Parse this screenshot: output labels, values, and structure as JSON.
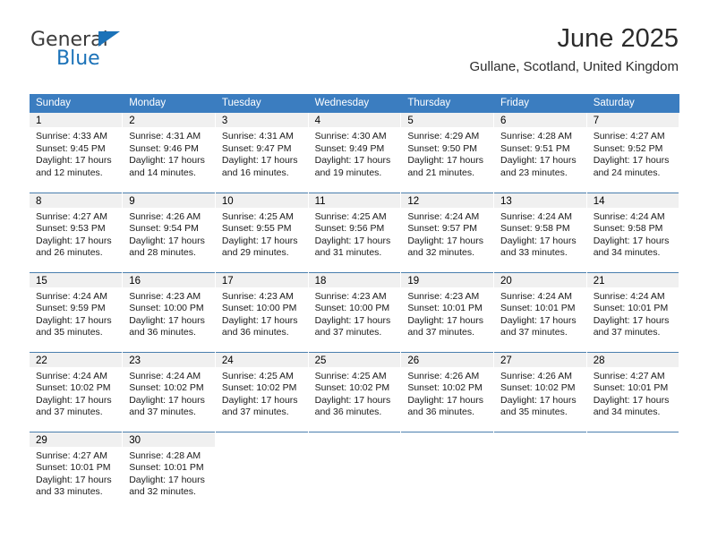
{
  "brand": {
    "name_part1": "General",
    "name_part2": "Blue",
    "triangle_color": "#1b72b8"
  },
  "header": {
    "title": "June 2025",
    "subtitle": "Gullane, Scotland, United Kingdom"
  },
  "colors": {
    "header_blue": "#3b7dc0",
    "daynum_gray": "#f0f0f0",
    "rule_blue": "#4a7fae"
  },
  "weekdays": [
    "Sunday",
    "Monday",
    "Tuesday",
    "Wednesday",
    "Thursday",
    "Friday",
    "Saturday"
  ],
  "labels": {
    "sunrise_prefix": "Sunrise: ",
    "sunset_prefix": "Sunset: ",
    "daylight_prefix": "Daylight: "
  },
  "weeks": [
    [
      {
        "day": "1",
        "sunrise": "Sunrise: 4:33 AM",
        "sunset": "Sunset: 9:45 PM",
        "daylight_line1": "Daylight: 17 hours",
        "daylight_line2": "and 12 minutes."
      },
      {
        "day": "2",
        "sunrise": "Sunrise: 4:31 AM",
        "sunset": "Sunset: 9:46 PM",
        "daylight_line1": "Daylight: 17 hours",
        "daylight_line2": "and 14 minutes."
      },
      {
        "day": "3",
        "sunrise": "Sunrise: 4:31 AM",
        "sunset": "Sunset: 9:47 PM",
        "daylight_line1": "Daylight: 17 hours",
        "daylight_line2": "and 16 minutes."
      },
      {
        "day": "4",
        "sunrise": "Sunrise: 4:30 AM",
        "sunset": "Sunset: 9:49 PM",
        "daylight_line1": "Daylight: 17 hours",
        "daylight_line2": "and 19 minutes."
      },
      {
        "day": "5",
        "sunrise": "Sunrise: 4:29 AM",
        "sunset": "Sunset: 9:50 PM",
        "daylight_line1": "Daylight: 17 hours",
        "daylight_line2": "and 21 minutes."
      },
      {
        "day": "6",
        "sunrise": "Sunrise: 4:28 AM",
        "sunset": "Sunset: 9:51 PM",
        "daylight_line1": "Daylight: 17 hours",
        "daylight_line2": "and 23 minutes."
      },
      {
        "day": "7",
        "sunrise": "Sunrise: 4:27 AM",
        "sunset": "Sunset: 9:52 PM",
        "daylight_line1": "Daylight: 17 hours",
        "daylight_line2": "and 24 minutes."
      }
    ],
    [
      {
        "day": "8",
        "sunrise": "Sunrise: 4:27 AM",
        "sunset": "Sunset: 9:53 PM",
        "daylight_line1": "Daylight: 17 hours",
        "daylight_line2": "and 26 minutes."
      },
      {
        "day": "9",
        "sunrise": "Sunrise: 4:26 AM",
        "sunset": "Sunset: 9:54 PM",
        "daylight_line1": "Daylight: 17 hours",
        "daylight_line2": "and 28 minutes."
      },
      {
        "day": "10",
        "sunrise": "Sunrise: 4:25 AM",
        "sunset": "Sunset: 9:55 PM",
        "daylight_line1": "Daylight: 17 hours",
        "daylight_line2": "and 29 minutes."
      },
      {
        "day": "11",
        "sunrise": "Sunrise: 4:25 AM",
        "sunset": "Sunset: 9:56 PM",
        "daylight_line1": "Daylight: 17 hours",
        "daylight_line2": "and 31 minutes."
      },
      {
        "day": "12",
        "sunrise": "Sunrise: 4:24 AM",
        "sunset": "Sunset: 9:57 PM",
        "daylight_line1": "Daylight: 17 hours",
        "daylight_line2": "and 32 minutes."
      },
      {
        "day": "13",
        "sunrise": "Sunrise: 4:24 AM",
        "sunset": "Sunset: 9:58 PM",
        "daylight_line1": "Daylight: 17 hours",
        "daylight_line2": "and 33 minutes."
      },
      {
        "day": "14",
        "sunrise": "Sunrise: 4:24 AM",
        "sunset": "Sunset: 9:58 PM",
        "daylight_line1": "Daylight: 17 hours",
        "daylight_line2": "and 34 minutes."
      }
    ],
    [
      {
        "day": "15",
        "sunrise": "Sunrise: 4:24 AM",
        "sunset": "Sunset: 9:59 PM",
        "daylight_line1": "Daylight: 17 hours",
        "daylight_line2": "and 35 minutes."
      },
      {
        "day": "16",
        "sunrise": "Sunrise: 4:23 AM",
        "sunset": "Sunset: 10:00 PM",
        "daylight_line1": "Daylight: 17 hours",
        "daylight_line2": "and 36 minutes."
      },
      {
        "day": "17",
        "sunrise": "Sunrise: 4:23 AM",
        "sunset": "Sunset: 10:00 PM",
        "daylight_line1": "Daylight: 17 hours",
        "daylight_line2": "and 36 minutes."
      },
      {
        "day": "18",
        "sunrise": "Sunrise: 4:23 AM",
        "sunset": "Sunset: 10:00 PM",
        "daylight_line1": "Daylight: 17 hours",
        "daylight_line2": "and 37 minutes."
      },
      {
        "day": "19",
        "sunrise": "Sunrise: 4:23 AM",
        "sunset": "Sunset: 10:01 PM",
        "daylight_line1": "Daylight: 17 hours",
        "daylight_line2": "and 37 minutes."
      },
      {
        "day": "20",
        "sunrise": "Sunrise: 4:24 AM",
        "sunset": "Sunset: 10:01 PM",
        "daylight_line1": "Daylight: 17 hours",
        "daylight_line2": "and 37 minutes."
      },
      {
        "day": "21",
        "sunrise": "Sunrise: 4:24 AM",
        "sunset": "Sunset: 10:01 PM",
        "daylight_line1": "Daylight: 17 hours",
        "daylight_line2": "and 37 minutes."
      }
    ],
    [
      {
        "day": "22",
        "sunrise": "Sunrise: 4:24 AM",
        "sunset": "Sunset: 10:02 PM",
        "daylight_line1": "Daylight: 17 hours",
        "daylight_line2": "and 37 minutes."
      },
      {
        "day": "23",
        "sunrise": "Sunrise: 4:24 AM",
        "sunset": "Sunset: 10:02 PM",
        "daylight_line1": "Daylight: 17 hours",
        "daylight_line2": "and 37 minutes."
      },
      {
        "day": "24",
        "sunrise": "Sunrise: 4:25 AM",
        "sunset": "Sunset: 10:02 PM",
        "daylight_line1": "Daylight: 17 hours",
        "daylight_line2": "and 37 minutes."
      },
      {
        "day": "25",
        "sunrise": "Sunrise: 4:25 AM",
        "sunset": "Sunset: 10:02 PM",
        "daylight_line1": "Daylight: 17 hours",
        "daylight_line2": "and 36 minutes."
      },
      {
        "day": "26",
        "sunrise": "Sunrise: 4:26 AM",
        "sunset": "Sunset: 10:02 PM",
        "daylight_line1": "Daylight: 17 hours",
        "daylight_line2": "and 36 minutes."
      },
      {
        "day": "27",
        "sunrise": "Sunrise: 4:26 AM",
        "sunset": "Sunset: 10:02 PM",
        "daylight_line1": "Daylight: 17 hours",
        "daylight_line2": "and 35 minutes."
      },
      {
        "day": "28",
        "sunrise": "Sunrise: 4:27 AM",
        "sunset": "Sunset: 10:01 PM",
        "daylight_line1": "Daylight: 17 hours",
        "daylight_line2": "and 34 minutes."
      }
    ],
    [
      {
        "day": "29",
        "sunrise": "Sunrise: 4:27 AM",
        "sunset": "Sunset: 10:01 PM",
        "daylight_line1": "Daylight: 17 hours",
        "daylight_line2": "and 33 minutes."
      },
      {
        "day": "30",
        "sunrise": "Sunrise: 4:28 AM",
        "sunset": "Sunset: 10:01 PM",
        "daylight_line1": "Daylight: 17 hours",
        "daylight_line2": "and 32 minutes."
      },
      {
        "day": "",
        "sunrise": "",
        "sunset": "",
        "daylight_line1": "",
        "daylight_line2": ""
      },
      {
        "day": "",
        "sunrise": "",
        "sunset": "",
        "daylight_line1": "",
        "daylight_line2": ""
      },
      {
        "day": "",
        "sunrise": "",
        "sunset": "",
        "daylight_line1": "",
        "daylight_line2": ""
      },
      {
        "day": "",
        "sunrise": "",
        "sunset": "",
        "daylight_line1": "",
        "daylight_line2": ""
      },
      {
        "day": "",
        "sunrise": "",
        "sunset": "",
        "daylight_line1": "",
        "daylight_line2": ""
      }
    ]
  ]
}
